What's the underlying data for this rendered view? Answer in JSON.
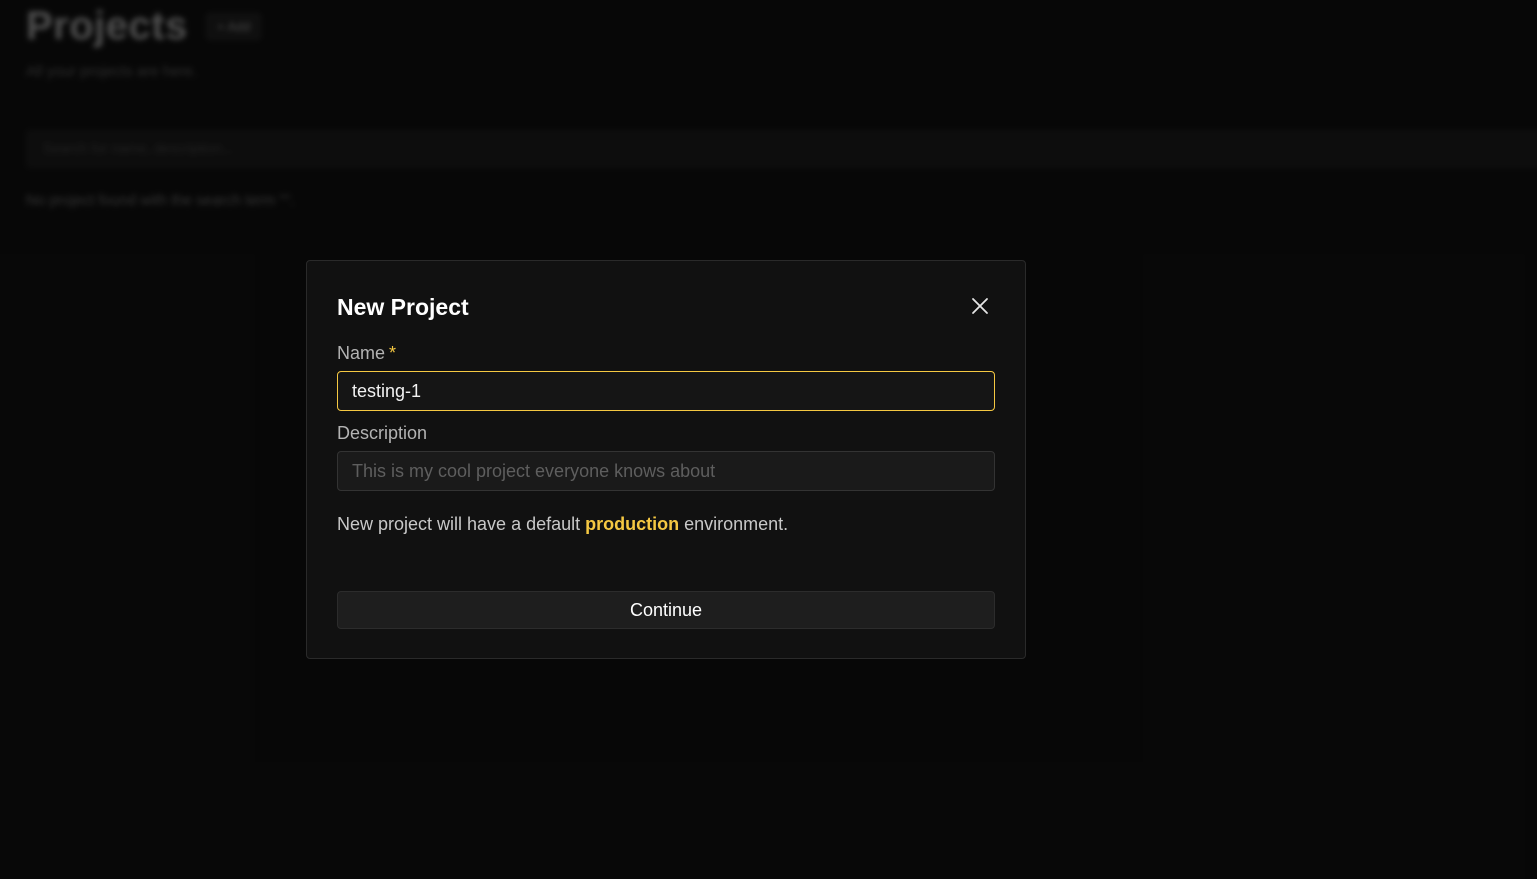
{
  "background": {
    "title": "Projects",
    "add_button": "+ Add",
    "subtitle": "All your projects are here.",
    "search_placeholder": "Search for name, description...",
    "empty_message": "No project found with the search term \"\"."
  },
  "modal": {
    "title": "New Project",
    "close_icon": "close-icon",
    "name_label": "Name",
    "required_marker": "*",
    "name_value": "testing-1",
    "description_label": "Description",
    "description_value": "",
    "description_placeholder": "This is my cool project everyone knows about",
    "info_prefix": "New project will have a default ",
    "info_highlight": "production",
    "info_suffix": " environment.",
    "continue_label": "Continue"
  },
  "colors": {
    "accent": "#f5c842",
    "background": "#0c0c0c",
    "modal_background": "#111111"
  }
}
